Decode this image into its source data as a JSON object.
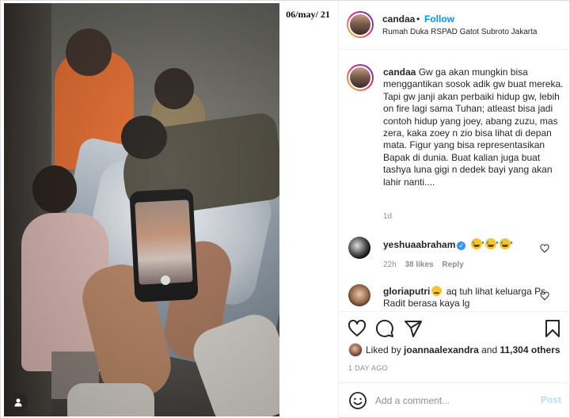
{
  "media": {
    "date_overlay": "06/may/ 21",
    "user_tag_icon": "person-icon"
  },
  "header": {
    "username": "candaa",
    "separator": "•",
    "follow_label": "Follow",
    "location": "Rumah Duka RSPAD Gatot Subroto Jakarta"
  },
  "caption": {
    "username": "candaa",
    "text": "Gw ga akan mungkin bisa menggantikan sosok adik gw buat mereka. Tapi gw janji akan perbaiki hidup gw, lebih on fire lagi sama Tuhan; atleast bisa jadi contoh hidup yang joey, abang zuzu, mas zera, kaka zoey n zio bisa lihat di depan mata. Figur yang bisa representasikan Bapak di dunia. Buat kalian juga buat tashya luna gigi n dedek bayi yang akan lahir nanti....",
    "time": "1d"
  },
  "comments": [
    {
      "username": "yeshuaabraham",
      "time": "22h",
      "likes": "38 likes",
      "reply_label": "Reply"
    },
    {
      "username": "gloriaputri",
      "text": "aq tuh lihat keluarga Ps Radit berasa kaya lg"
    }
  ],
  "likes": {
    "prefix": "Liked by",
    "user": "joannaalexandra",
    "and": "and",
    "others": "11,304 others"
  },
  "post_date": "1 DAY AGO",
  "add_comment": {
    "placeholder": "Add a comment...",
    "post_label": "Post"
  },
  "colors": {
    "follow": "#0095f6",
    "post_disabled": "#b2dffc",
    "verified": "#3897f0",
    "muted": "#8e8e8e"
  },
  "icons": [
    "heart-icon",
    "comment-icon",
    "share-icon",
    "bookmark-icon",
    "smile-icon",
    "verified-icon",
    "person-icon"
  ]
}
